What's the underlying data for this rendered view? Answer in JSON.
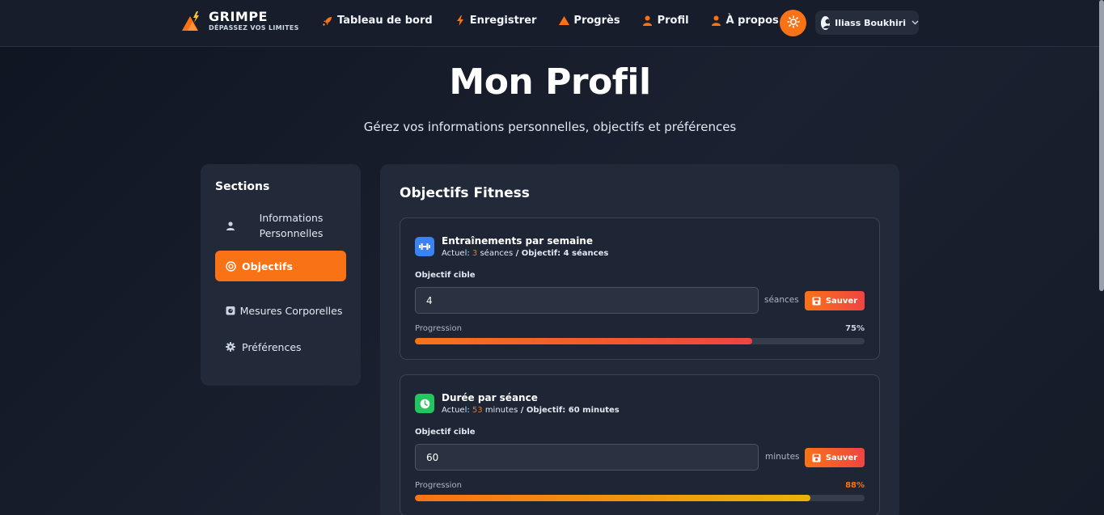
{
  "brand": {
    "name": "GRIMPE",
    "tagline": "DÉPASSEZ VOS LIMITES"
  },
  "nav": [
    {
      "label": "Tableau de bord",
      "icon": "rocket-icon"
    },
    {
      "label": "Enregistrer",
      "icon": "bolt-icon"
    },
    {
      "label": "Progrès",
      "icon": "mountain-icon"
    },
    {
      "label": "Profil",
      "icon": "user-icon"
    },
    {
      "label": "À propos",
      "icon": "user-icon"
    }
  ],
  "theme_toggle": {
    "icon": "sun-icon",
    "color": "#f97316"
  },
  "user": {
    "name": "Iliass Boukhiri",
    "icon": "user-circle-icon"
  },
  "header": {
    "title": "Mon Profil",
    "subtitle": "Gérez vos informations personnelles, objectifs et préférences"
  },
  "sidebar": {
    "title": "Sections",
    "items": [
      {
        "label": "Informations Personnelles",
        "icon": "user-icon",
        "active": false
      },
      {
        "label": "Objectifs",
        "icon": "target-icon",
        "active": true
      },
      {
        "label": "Mesures Corporelles",
        "icon": "scale-icon",
        "active": false
      },
      {
        "label": "Préférences",
        "icon": "gear-icon",
        "active": false
      }
    ]
  },
  "main": {
    "title": "Objectifs Fitness",
    "goals": [
      {
        "name": "Entraînements par semaine",
        "icon": "dumbbell-icon",
        "icon_color": "#3b82f6",
        "current_prefix": "Actuel: ",
        "current": "3",
        "current_unit": " séances",
        "objective_text": " / Objectif: 4 séances",
        "target_label": "Objectif cible",
        "target_value": "4",
        "unit": "séances",
        "save_label": "Sauver",
        "progress_label": "Progression",
        "progress_text": "75%",
        "progress": 0.75,
        "progress_text_color": "#cbd5e1",
        "bar_color_start": "#f97316",
        "bar_color_end": "#ef4444"
      },
      {
        "name": "Durée par séance",
        "icon": "clock-icon",
        "icon_color": "#22c55e",
        "current_prefix": "Actuel: ",
        "current": "53",
        "current_unit": " minutes",
        "objective_text": " / Objectif: 60 minutes",
        "target_label": "Objectif cible",
        "target_value": "60",
        "unit": "minutes",
        "save_label": "Sauver",
        "progress_label": "Progression",
        "progress_text": "88%",
        "progress": 0.88,
        "progress_text_color": "#f97316",
        "bar_color_start": "#f97316",
        "bar_color_end": "#eab308"
      }
    ]
  }
}
